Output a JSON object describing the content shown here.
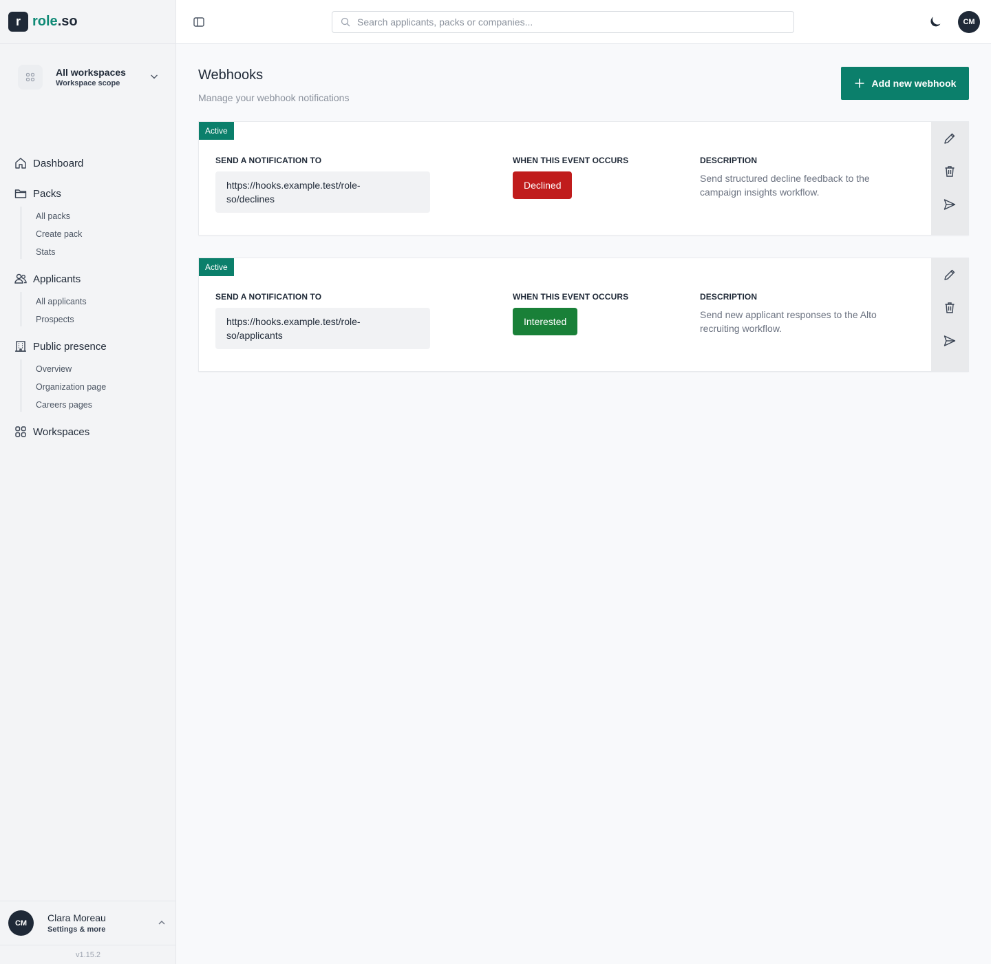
{
  "brand": {
    "mark": "r",
    "name_part1": "role",
    "name_part2": ".so"
  },
  "workspace": {
    "title": "All workspaces",
    "subtitle": "Workspace scope"
  },
  "nav": {
    "dashboard": "Dashboard",
    "packs": {
      "label": "Packs",
      "items": [
        "All packs",
        "Create pack",
        "Stats"
      ]
    },
    "applicants": {
      "label": "Applicants",
      "items": [
        "All applicants",
        "Prospects"
      ]
    },
    "public_presence": {
      "label": "Public presence",
      "items": [
        "Overview",
        "Organization page",
        "Careers pages"
      ]
    },
    "workspaces": "Workspaces"
  },
  "user": {
    "initials": "CM",
    "name": "Clara Moreau",
    "subtitle": "Settings & more"
  },
  "version": "v1.15.2",
  "topbar": {
    "search_placeholder": "Search applicants, packs or companies...",
    "avatar_initials": "CM"
  },
  "page": {
    "title": "Webhooks",
    "subtitle": "Manage your webhook notifications",
    "add_button": "Add new webhook"
  },
  "labels": {
    "send_to": "SEND A NOTIFICATION TO",
    "event": "WHEN THIS EVENT OCCURS",
    "description": "DESCRIPTION"
  },
  "webhooks": [
    {
      "status": "Active",
      "url_line1": "https://hooks.example.test/role-",
      "url_line2": "so/declines",
      "event": "Declined",
      "event_color": "#c01c1c",
      "description": "Send structured decline feedback to the campaign insights workflow."
    },
    {
      "status": "Active",
      "url_line1": "https://hooks.example.test/role-",
      "url_line2": "so/applicants",
      "event": "Interested",
      "event_color": "#198038",
      "description": "Send new applicant responses to the Alto recruiting workflow."
    }
  ],
  "colors": {
    "accent": "#0b7f6b",
    "dark": "#1f2937"
  }
}
